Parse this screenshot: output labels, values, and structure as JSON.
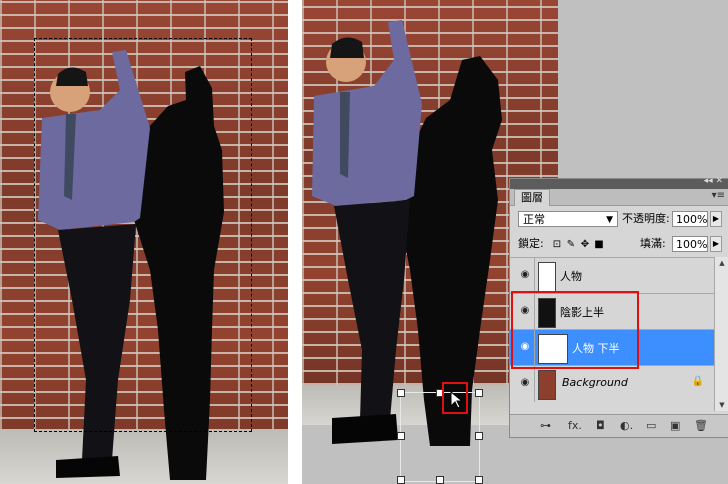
{
  "layers_panel": {
    "tab_label": "圖層",
    "collapse_glyph": "◂◂ ✕",
    "menu_glyph": "▾≡",
    "blend_mode": "正常",
    "opacity_label": "不透明度:",
    "opacity_value": "100%",
    "lock_label": "鎖定:",
    "fill_label": "填滿:",
    "fill_value": "100%",
    "layers": [
      {
        "name": "人物",
        "visible": true,
        "selected": false
      },
      {
        "name": "陰影上半",
        "visible": true,
        "selected": false
      },
      {
        "name": "人物 下半",
        "visible": true,
        "selected": true
      },
      {
        "name": "Background",
        "visible": true,
        "selected": false,
        "locked": true
      }
    ],
    "bottom_icons": [
      "link-icon",
      "fx-icon",
      "mask-icon",
      "adjustment-icon",
      "group-icon",
      "new-layer-icon",
      "trash-icon"
    ],
    "bottom_glyphs": [
      "⊶",
      "fx.",
      "◘",
      "◐.",
      "▭",
      "▣",
      "🗑"
    ]
  },
  "colors": {
    "selected_layer": "#3d8fff",
    "highlight_box": "#e01010",
    "panel_bg": "#d6d6d6"
  }
}
